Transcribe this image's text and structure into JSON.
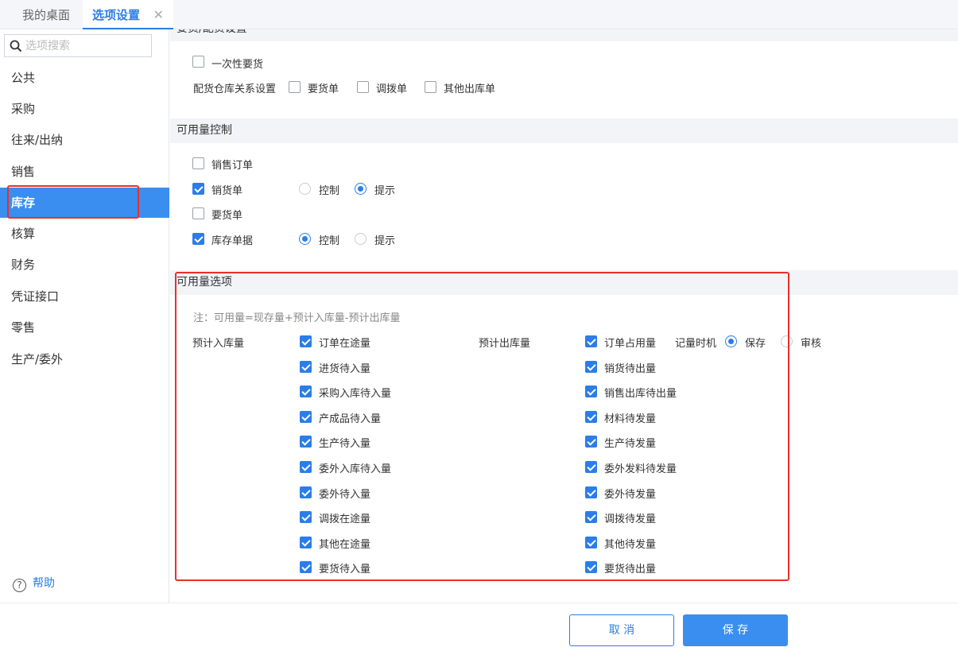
{
  "tabs": [
    {
      "label": "我的桌面"
    },
    {
      "label": "选项设置",
      "close": "✕"
    }
  ],
  "search": {
    "placeholder": "选项搜索"
  },
  "nav": [
    {
      "label": "公共"
    },
    {
      "label": "采购"
    },
    {
      "label": "往来/出纳"
    },
    {
      "label": "销售"
    },
    {
      "label": "库存",
      "active": true
    },
    {
      "label": "核算"
    },
    {
      "label": "财务"
    },
    {
      "label": "凭证接口"
    },
    {
      "label": "零售"
    },
    {
      "label": "生产/委外"
    }
  ],
  "help": {
    "label": "帮助",
    "icon": "question-circle-icon"
  },
  "section1": {
    "title": "要货/配货设置",
    "once": {
      "label": "一次性要货",
      "checked": false
    },
    "warehouse_label": "配货仓库关系设置",
    "warehouse_opts": [
      {
        "label": "要货单",
        "checked": false
      },
      {
        "label": "调拨单",
        "checked": false
      },
      {
        "label": "其他出库单",
        "checked": false
      }
    ]
  },
  "section2": {
    "title": "可用量控制",
    "rows": [
      {
        "label": "销售订单",
        "checked": false
      },
      {
        "label": "销货单",
        "checked": true,
        "control": "控制",
        "hint": "提示",
        "selected": "提示"
      },
      {
        "label": "要货单",
        "checked": false
      },
      {
        "label": "库存单据",
        "checked": true,
        "control": "控制",
        "hint": "提示",
        "selected": "控制"
      }
    ]
  },
  "section3": {
    "title": "可用量选项",
    "note": "注：可用量=现存量+预计入库量-预计出库量",
    "in_label": "预计入库量",
    "out_label": "预计出库量",
    "timing_label": "记量时机",
    "timing_opts": [
      "保存",
      "审核"
    ],
    "timing_selected": "保存",
    "in_items": [
      "订单在途量",
      "进货待入量",
      "采购入库待入量",
      "产成品待入量",
      "生产待入量",
      "委外入库待入量",
      "委外待入量",
      "调拨在途量",
      "其他在途量",
      "要货待入量"
    ],
    "out_items": [
      "订单占用量",
      "销货待出量",
      "销售出库待出量",
      "材料待发量",
      "生产待发量",
      "委外发料待发量",
      "委外待发量",
      "调拨待发量",
      "其他待发量",
      "要货待出量"
    ]
  },
  "footer": {
    "cancel": "取 消",
    "save": "保 存"
  },
  "colors": {
    "accent": "#2b7de9",
    "highlight": "#e8302b"
  }
}
